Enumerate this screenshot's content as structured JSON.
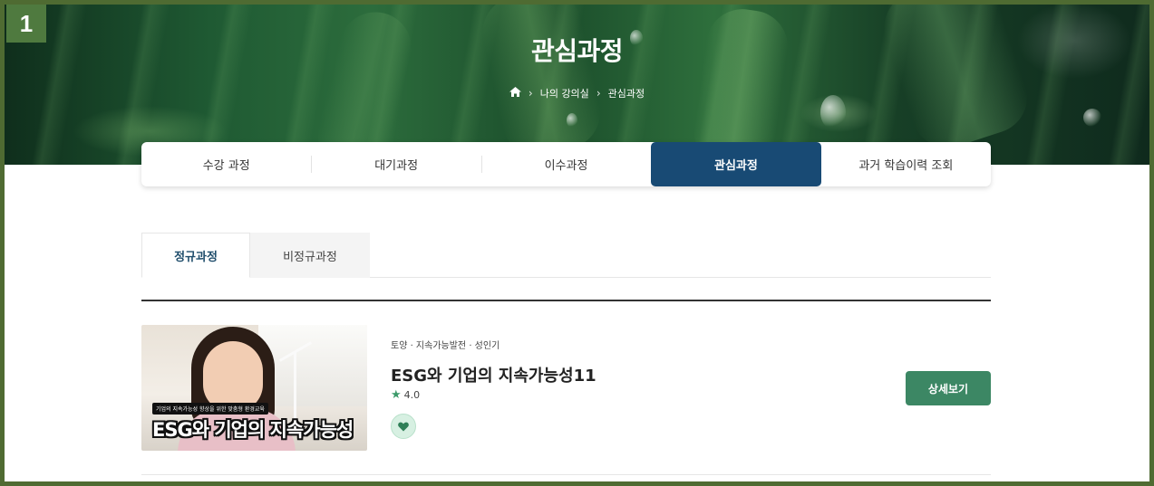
{
  "step_badge": "1",
  "hero": {
    "title": "관심과정",
    "breadcrumb": {
      "home_icon": "home-icon",
      "items": [
        "나의 강의실",
        "관심과정"
      ]
    }
  },
  "main_tabs": [
    {
      "label": "수강 과정",
      "active": false
    },
    {
      "label": "대기과정",
      "active": false
    },
    {
      "label": "이수과정",
      "active": false
    },
    {
      "label": "관심과정",
      "active": true
    },
    {
      "label": "과거 학습이력 조회",
      "active": false
    }
  ],
  "sub_tabs": [
    {
      "label": "정규과정",
      "active": true
    },
    {
      "label": "비정규과정",
      "active": false
    }
  ],
  "courses": [
    {
      "thumbnail": {
        "caption_small": "기업의 지속가능성 향상을 위한 맞춤형 환경교육",
        "caption_big": "ESG와 기업의 지속가능성"
      },
      "category": "토양 · 지속가능발전 · 성인기",
      "title": "ESG와 기업의 지속가능성11",
      "rating": "4.0",
      "rating_icon": "star-icon",
      "favorite_icon": "heart-icon",
      "detail_label": "상세보기"
    }
  ],
  "colors": {
    "frame": "#4f6b32",
    "active_tab": "#184a74",
    "detail_button": "#3c8764",
    "star": "#3c9a6a"
  }
}
